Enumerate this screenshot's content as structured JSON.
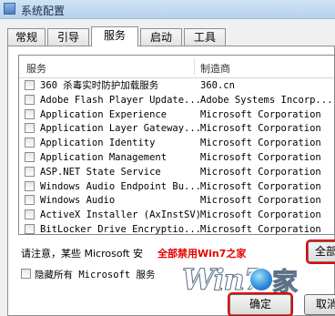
{
  "window": {
    "title": "系统配置"
  },
  "tabs": [
    {
      "label": "常规",
      "active": false
    },
    {
      "label": "引导",
      "active": false
    },
    {
      "label": "服务",
      "active": true
    },
    {
      "label": "启动",
      "active": false
    },
    {
      "label": "工具",
      "active": false
    }
  ],
  "list": {
    "columns": {
      "service": "服务",
      "manufacturer": "制造商"
    },
    "rows": [
      {
        "service": "360 杀毒实时防护加载服务",
        "manufacturer": "360.cn",
        "checked": false
      },
      {
        "service": "Adobe Flash Player Update...",
        "manufacturer": "Adobe Systems Incorp...",
        "checked": false
      },
      {
        "service": "Application Experience",
        "manufacturer": "Microsoft Corporation",
        "checked": false
      },
      {
        "service": "Application Layer Gateway...",
        "manufacturer": "Microsoft Corporation",
        "checked": false
      },
      {
        "service": "Application Identity",
        "manufacturer": "Microsoft Corporation",
        "checked": false
      },
      {
        "service": "Application Management",
        "manufacturer": "Microsoft Corporation",
        "checked": false
      },
      {
        "service": "ASP.NET State Service",
        "manufacturer": "Microsoft Corporation",
        "checked": false
      },
      {
        "service": "Windows Audio Endpoint Bu...",
        "manufacturer": "Microsoft Corporation",
        "checked": false
      },
      {
        "service": "Windows Audio",
        "manufacturer": "Microsoft Corporation",
        "checked": false
      },
      {
        "service": "ActiveX Installer (AxInstSV)",
        "manufacturer": "Microsoft Corporation",
        "checked": false
      },
      {
        "service": "BitLocker Drive Encryptio...",
        "manufacturer": "Microsoft Corporation",
        "checked": false
      }
    ]
  },
  "note": {
    "text": "请注意，某些 Microsoft 安",
    "watermark": "全部禁用Win7之家",
    "overlay": "全部启用"
  },
  "hide_ms": {
    "label": "隐藏所有 Microsoft 服务",
    "checked": false
  },
  "buttons": {
    "enable_all": "全部",
    "ok": "确定",
    "cancel": "取消"
  },
  "watermark": {
    "logo": "Win7",
    "char": "家",
    "url": "www.win7zhijia.cn"
  },
  "colors": {
    "highlight": "#e60000",
    "title_bar": "#cfe3f7"
  }
}
